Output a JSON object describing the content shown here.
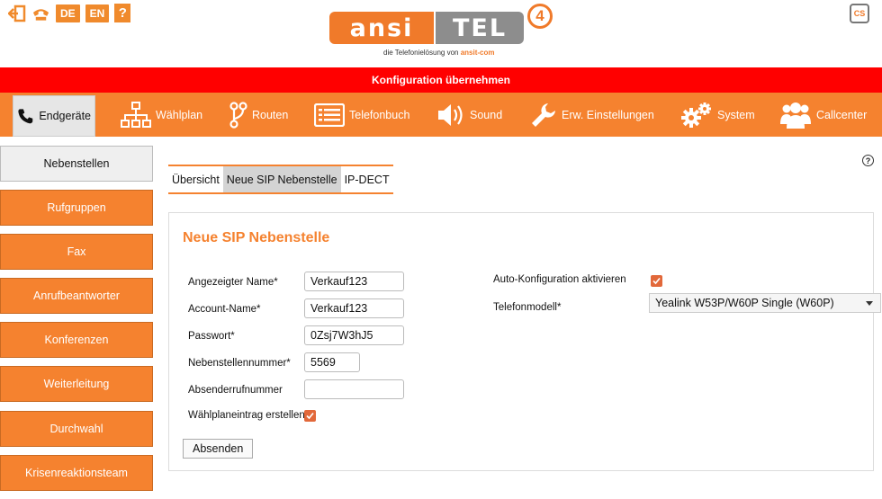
{
  "header": {
    "languages": [
      "DE",
      "EN"
    ],
    "help_glyph": "?",
    "logo": {
      "left_text": "ansi",
      "right_text": "TEL",
      "version": "4",
      "tagline": "die Telefonielösung von",
      "tagline_brand": "ansit-com"
    },
    "cs_text": "CS"
  },
  "apply_banner": "Konfiguration übernehmen",
  "nav": {
    "items": [
      {
        "label": "Endgeräte",
        "icon": "phone-icon"
      },
      {
        "label": "Wählplan",
        "icon": "hierarchy-icon"
      },
      {
        "label": "Routen",
        "icon": "route-icon"
      },
      {
        "label": "Telefonbuch",
        "icon": "phonebook-icon"
      },
      {
        "label": "Sound",
        "icon": "speaker-icon"
      },
      {
        "label": "Erw. Einstellungen",
        "icon": "wrench-icon"
      },
      {
        "label": "System",
        "icon": "gears-icon"
      },
      {
        "label": "Callcenter",
        "icon": "users-icon"
      }
    ]
  },
  "sidebar": {
    "items": [
      "Nebenstellen",
      "Rufgruppen",
      "Fax",
      "Anrufbeantworter",
      "Konferenzen",
      "Weiterleitung",
      "Durchwahl",
      "Krisenreaktionsteam"
    ]
  },
  "subtabs": [
    "Übersicht",
    "Neue SIP Nebenstelle",
    "IP-DECT"
  ],
  "help_glyph": "?",
  "form": {
    "title": "Neue SIP Nebenstelle",
    "display_name_label": "Angezeigter Name*",
    "display_name_value": "Verkauf123",
    "account_label": "Account-Name*",
    "account_value": "Verkauf123",
    "password_label": "Passwort*",
    "password_value": "0Zsj7W3hJ5",
    "extension_label": "Nebenstellennummer*",
    "extension_value": "5569",
    "sender_label": "Absenderrufnummer",
    "sender_value": "",
    "dialplan_label": "Wählplaneintrag erstellen",
    "dialplan_checked": true,
    "autoconfig_label": "Auto-Konfiguration aktivieren",
    "autoconfig_checked": true,
    "phone_model_label": "Telefonmodell*",
    "phone_model_value": "Yealink W53P/W60P Single (W60P)",
    "submit_label": "Absenden"
  },
  "colors": {
    "accent": "#f5822f",
    "banner": "#ff0000",
    "checkbox": "#e2683a"
  }
}
